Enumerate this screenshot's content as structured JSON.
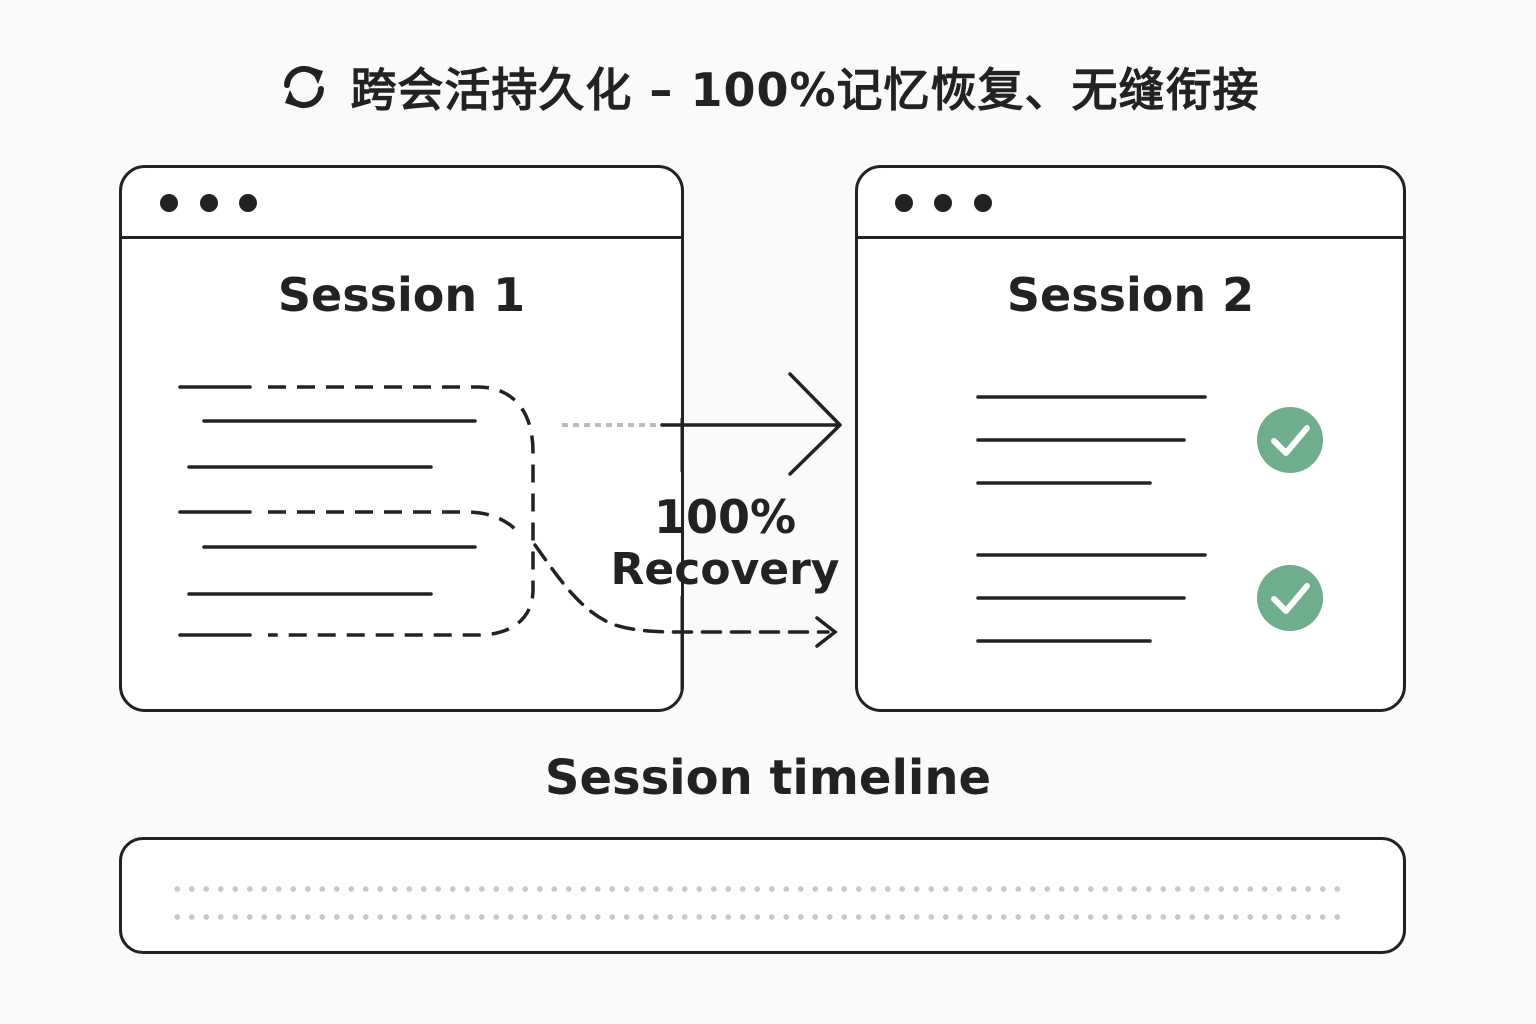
{
  "title": {
    "icon": "sync-icon",
    "text": "跨会活持久化 – 100%记忆恢复、无缝衔接"
  },
  "session1": {
    "title": "Session 1"
  },
  "session2": {
    "title": "Session 2",
    "check_icons": [
      "check-icon",
      "check-icon"
    ]
  },
  "recovery": {
    "percent": "100%",
    "label": "Recovery"
  },
  "timeline": {
    "label": "Session timeline"
  },
  "colors": {
    "stroke": "#222222",
    "check": "#6fae8c",
    "background": "#fafafa",
    "dots": "#c8c8c8"
  }
}
